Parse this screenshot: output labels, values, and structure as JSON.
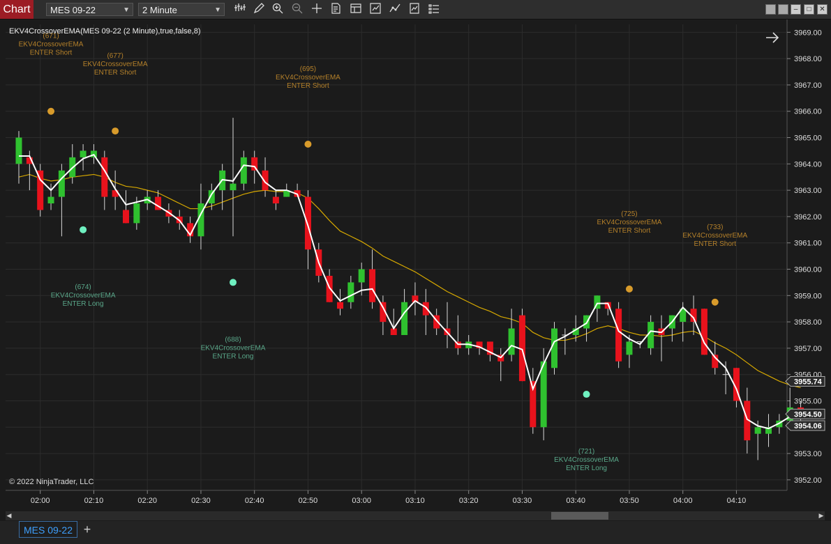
{
  "toolbar": {
    "chart_label": "Chart",
    "instrument": "MES 09-22",
    "interval": "2 Minute",
    "icons": [
      "bars-type-icon",
      "draw-pencil-icon",
      "zoom-in-icon",
      "zoom-out-icon",
      "crosshair-icon",
      "data-box-icon",
      "properties-icon",
      "chart-trader-icon",
      "strategies-icon",
      "indicators-icon",
      "templates-icon"
    ]
  },
  "window": {
    "buttons": [
      "minimize",
      "restore",
      "maximize",
      "close"
    ]
  },
  "chart": {
    "indicator_label": "EKV4CrossoverEMA(MES 09-22 (2 Minute),true,false,8)",
    "copyright": "© 2022 NinjaTrader, LLC",
    "price_badges": [
      {
        "value": "3955.74",
        "price": 3955.74
      },
      {
        "value": "3954.50",
        "price": 3954.5
      },
      {
        "value": "3954.06",
        "price": 3954.06
      }
    ],
    "annotations": [
      {
        "id": "(671)",
        "name": "EKV4CrossoverEMA",
        "action": "ENTER Short",
        "bar": 3,
        "side": "short",
        "price": 3966.0
      },
      {
        "id": "(677)",
        "name": "EKV4CrossoverEMA",
        "action": "ENTER Short",
        "bar": 9,
        "side": "short",
        "price": 3965.25
      },
      {
        "id": "(695)",
        "name": "EKV4CrossoverEMA",
        "action": "ENTER Short",
        "bar": 27,
        "side": "short",
        "price": 3964.75
      },
      {
        "id": "(725)",
        "name": "EKV4CrossoverEMA",
        "action": "ENTER Short",
        "bar": 57,
        "side": "short",
        "price": 3959.25
      },
      {
        "id": "(733)",
        "name": "EKV4CrossoverEMA",
        "action": "ENTER Short",
        "bar": 65,
        "side": "short",
        "price": 3958.75
      },
      {
        "id": "(674)",
        "name": "EKV4CrossoverEMA",
        "action": "ENTER Long",
        "bar": 6,
        "side": "long",
        "price": 3961.5
      },
      {
        "id": "(688)",
        "name": "EKV4CrossoverEMA",
        "action": "ENTER Long",
        "bar": 20,
        "side": "long",
        "price": 3959.5
      },
      {
        "id": "(721)",
        "name": "EKV4CrossoverEMA",
        "action": "ENTER Long",
        "bar": 53,
        "side": "long",
        "price": 3955.25
      }
    ]
  },
  "chart_data": {
    "type": "candlestick",
    "instrument": "MES 09-22",
    "interval": "2 Minute",
    "y_axis": {
      "min": 3951.6,
      "max": 3969.3,
      "ticks": [
        "3952.00",
        "3953.00",
        "3954.00",
        "3955.00",
        "3956.00",
        "3957.00",
        "3958.00",
        "3959.00",
        "3960.00",
        "3961.00",
        "3962.00",
        "3963.00",
        "3964.00",
        "3965.00",
        "3966.00",
        "3967.00",
        "3968.00",
        "3969.00"
      ]
    },
    "x_axis": {
      "labels": [
        "02:00",
        "02:10",
        "02:20",
        "02:30",
        "02:40",
        "02:50",
        "03:00",
        "03:10",
        "03:20",
        "03:30",
        "03:40",
        "03:50",
        "04:00",
        "04:10"
      ],
      "label_bar_index": [
        2,
        7,
        12,
        17,
        22,
        27,
        32,
        37,
        42,
        47,
        52,
        57,
        62,
        67
      ]
    },
    "colors": {
      "up": "#2fc12f",
      "down": "#e8121c",
      "ema": "#d6a800",
      "fast_line": "#ffffff",
      "short_marker": "#d89b2b",
      "long_marker": "#6ff0c0",
      "short_text": "#b5812a",
      "long_text": "#5aa88a"
    },
    "candles": [
      {
        "o": 3964.0,
        "h": 3965.25,
        "l": 3963.25,
        "c": 3965.0
      },
      {
        "o": 3964.25,
        "h": 3964.5,
        "l": 3963.0,
        "c": 3964.0
      },
      {
        "o": 3963.75,
        "h": 3964.0,
        "l": 3962.0,
        "c": 3962.25
      },
      {
        "o": 3962.5,
        "h": 3963.25,
        "l": 3962.25,
        "c": 3962.75
      },
      {
        "o": 3962.75,
        "h": 3964.0,
        "l": 3961.25,
        "c": 3963.75
      },
      {
        "o": 3963.5,
        "h": 3964.75,
        "l": 3963.25,
        "c": 3964.25
      },
      {
        "o": 3964.25,
        "h": 3964.75,
        "l": 3963.75,
        "c": 3964.5
      },
      {
        "o": 3964.25,
        "h": 3964.75,
        "l": 3964.0,
        "c": 3964.5
      },
      {
        "o": 3964.25,
        "h": 3964.5,
        "l": 3962.25,
        "c": 3962.75
      },
      {
        "o": 3963.0,
        "h": 3963.75,
        "l": 3962.25,
        "c": 3962.75
      },
      {
        "o": 3962.25,
        "h": 3963.0,
        "l": 3961.75,
        "c": 3961.75
      },
      {
        "o": 3961.75,
        "h": 3962.75,
        "l": 3961.5,
        "c": 3962.5
      },
      {
        "o": 3962.5,
        "h": 3963.0,
        "l": 3962.25,
        "c": 3962.75
      },
      {
        "o": 3962.75,
        "h": 3963.0,
        "l": 3962.25,
        "c": 3962.25
      },
      {
        "o": 3962.25,
        "h": 3962.5,
        "l": 3961.75,
        "c": 3962.0
      },
      {
        "o": 3962.0,
        "h": 3962.25,
        "l": 3961.5,
        "c": 3961.75
      },
      {
        "o": 3961.75,
        "h": 3962.0,
        "l": 3961.0,
        "c": 3961.25
      },
      {
        "o": 3961.25,
        "h": 3963.25,
        "l": 3960.75,
        "c": 3962.5
      },
      {
        "o": 3962.5,
        "h": 3963.25,
        "l": 3962.25,
        "c": 3963.0
      },
      {
        "o": 3963.0,
        "h": 3964.0,
        "l": 3962.25,
        "c": 3963.75
      },
      {
        "o": 3963.0,
        "h": 3965.75,
        "l": 3961.25,
        "c": 3963.25
      },
      {
        "o": 3963.25,
        "h": 3964.5,
        "l": 3963.0,
        "c": 3964.25
      },
      {
        "o": 3964.25,
        "h": 3964.5,
        "l": 3963.25,
        "c": 3963.75
      },
      {
        "o": 3963.75,
        "h": 3964.25,
        "l": 3962.75,
        "c": 3963.0
      },
      {
        "o": 3962.75,
        "h": 3963.0,
        "l": 3962.25,
        "c": 3962.5
      },
      {
        "o": 3962.75,
        "h": 3963.25,
        "l": 3962.75,
        "c": 3963.0
      },
      {
        "o": 3963.0,
        "h": 3963.25,
        "l": 3962.75,
        "c": 3962.75
      },
      {
        "o": 3962.75,
        "h": 3963.0,
        "l": 3960.0,
        "c": 3960.75
      },
      {
        "o": 3960.75,
        "h": 3961.0,
        "l": 3959.5,
        "c": 3959.75
      },
      {
        "o": 3959.75,
        "h": 3960.0,
        "l": 3958.75,
        "c": 3958.75
      },
      {
        "o": 3958.75,
        "h": 3959.25,
        "l": 3958.25,
        "c": 3958.5
      },
      {
        "o": 3958.75,
        "h": 3959.75,
        "l": 3958.5,
        "c": 3959.5
      },
      {
        "o": 3959.5,
        "h": 3960.25,
        "l": 3959.0,
        "c": 3960.0
      },
      {
        "o": 3960.0,
        "h": 3960.75,
        "l": 3958.5,
        "c": 3958.75
      },
      {
        "o": 3958.75,
        "h": 3959.0,
        "l": 3957.5,
        "c": 3958.0
      },
      {
        "o": 3957.75,
        "h": 3958.5,
        "l": 3957.5,
        "c": 3957.5
      },
      {
        "o": 3957.5,
        "h": 3959.25,
        "l": 3957.5,
        "c": 3958.75
      },
      {
        "o": 3959.0,
        "h": 3959.5,
        "l": 3958.25,
        "c": 3958.75
      },
      {
        "o": 3958.75,
        "h": 3959.25,
        "l": 3957.5,
        "c": 3958.25
      },
      {
        "o": 3958.25,
        "h": 3958.5,
        "l": 3957.5,
        "c": 3957.75
      },
      {
        "o": 3957.75,
        "h": 3958.75,
        "l": 3957.0,
        "c": 3957.5
      },
      {
        "o": 3957.25,
        "h": 3958.25,
        "l": 3956.75,
        "c": 3957.0
      },
      {
        "o": 3957.0,
        "h": 3957.5,
        "l": 3956.75,
        "c": 3957.25
      },
      {
        "o": 3957.25,
        "h": 3957.25,
        "l": 3956.75,
        "c": 3957.0
      },
      {
        "o": 3957.25,
        "h": 3957.25,
        "l": 3956.5,
        "c": 3956.75
      },
      {
        "o": 3956.75,
        "h": 3957.0,
        "l": 3955.75,
        "c": 3956.5
      },
      {
        "o": 3956.75,
        "h": 3958.5,
        "l": 3956.5,
        "c": 3957.75
      },
      {
        "o": 3958.25,
        "h": 3958.5,
        "l": 3955.75,
        "c": 3955.75
      },
      {
        "o": 3955.75,
        "h": 3956.25,
        "l": 3953.75,
        "c": 3954.0
      },
      {
        "o": 3954.0,
        "h": 3957.0,
        "l": 3953.5,
        "c": 3956.5
      },
      {
        "o": 3956.25,
        "h": 3958.0,
        "l": 3956.0,
        "c": 3957.75
      },
      {
        "o": 3957.5,
        "h": 3957.75,
        "l": 3956.75,
        "c": 3957.5
      },
      {
        "o": 3957.5,
        "h": 3958.25,
        "l": 3957.25,
        "c": 3957.75
      },
      {
        "o": 3957.75,
        "h": 3958.25,
        "l": 3957.25,
        "c": 3958.25
      },
      {
        "o": 3958.5,
        "h": 3959.0,
        "l": 3958.0,
        "c": 3959.0
      },
      {
        "o": 3958.75,
        "h": 3958.75,
        "l": 3958.25,
        "c": 3958.5
      },
      {
        "o": 3958.5,
        "h": 3958.75,
        "l": 3956.25,
        "c": 3956.5
      },
      {
        "o": 3956.75,
        "h": 3957.5,
        "l": 3956.25,
        "c": 3957.25
      },
      {
        "o": 3957.25,
        "h": 3957.25,
        "l": 3957.0,
        "c": 3957.25
      },
      {
        "o": 3957.0,
        "h": 3958.25,
        "l": 3956.75,
        "c": 3958.0
      },
      {
        "o": 3957.75,
        "h": 3958.25,
        "l": 3956.5,
        "c": 3957.5
      },
      {
        "o": 3957.75,
        "h": 3958.25,
        "l": 3957.25,
        "c": 3958.25
      },
      {
        "o": 3958.0,
        "h": 3958.75,
        "l": 3957.25,
        "c": 3958.5
      },
      {
        "o": 3958.5,
        "h": 3959.0,
        "l": 3957.5,
        "c": 3958.0
      },
      {
        "o": 3958.5,
        "h": 3958.5,
        "l": 3956.75,
        "c": 3956.75
      },
      {
        "o": 3956.75,
        "h": 3957.25,
        "l": 3956.0,
        "c": 3956.25
      },
      {
        "o": 3956.0,
        "h": 3956.5,
        "l": 3955.25,
        "c": 3956.0
      },
      {
        "o": 3956.25,
        "h": 3956.25,
        "l": 3954.75,
        "c": 3955.0
      },
      {
        "o": 3955.0,
        "h": 3955.5,
        "l": 3953.0,
        "c": 3953.5
      },
      {
        "o": 3953.75,
        "h": 3954.25,
        "l": 3952.75,
        "c": 3954.0
      },
      {
        "o": 3953.75,
        "h": 3954.5,
        "l": 3953.25,
        "c": 3954.0
      },
      {
        "o": 3954.0,
        "h": 3954.5,
        "l": 3953.75,
        "c": 3954.25
      },
      {
        "o": 3954.25,
        "h": 3955.5,
        "l": 3954.0,
        "c": 3954.75
      },
      {
        "o": 3954.75,
        "h": 3955.0,
        "l": 3954.25,
        "c": 3954.5
      }
    ],
    "ema": [
      3963.5,
      3963.6,
      3963.45,
      3963.35,
      3963.4,
      3963.5,
      3963.55,
      3963.6,
      3963.5,
      3963.3,
      3963.15,
      3963.1,
      3963.0,
      3962.9,
      3962.7,
      3962.5,
      3962.3,
      3962.3,
      3962.4,
      3962.55,
      3962.7,
      3962.85,
      3962.95,
      3963.0,
      3962.95,
      3962.95,
      3962.9,
      3962.7,
      3962.3,
      3961.85,
      3961.45,
      3961.25,
      3961.05,
      3960.8,
      3960.5,
      3960.3,
      3960.1,
      3959.9,
      3959.65,
      3959.4,
      3959.15,
      3958.95,
      3958.75,
      3958.55,
      3958.4,
      3958.2,
      3958.1,
      3957.95,
      3957.6,
      3957.4,
      3957.3,
      3957.3,
      3957.4,
      3957.55,
      3957.75,
      3957.85,
      3957.75,
      3957.6,
      3957.5,
      3957.5,
      3957.45,
      3957.5,
      3957.6,
      3957.65,
      3957.45,
      3957.2,
      3957.0,
      3956.75,
      3956.45,
      3956.15,
      3955.95,
      3955.75,
      3955.6,
      3955.5
    ],
    "fast_line": [
      3964.3,
      3964.3,
      3963.4,
      3963.0,
      3963.45,
      3963.85,
      3964.2,
      3964.35,
      3963.75,
      3963.05,
      3962.45,
      3962.55,
      3962.65,
      3962.4,
      3962.15,
      3961.85,
      3961.3,
      3962.1,
      3962.85,
      3963.4,
      3963.35,
      3963.95,
      3963.9,
      3963.3,
      3963.0,
      3963.0,
      3962.85,
      3961.65,
      3960.25,
      3959.3,
      3958.8,
      3959.0,
      3959.2,
      3959.25,
      3958.55,
      3957.75,
      3958.35,
      3958.8,
      3958.55,
      3958.05,
      3957.6,
      3957.15,
      3957.15,
      3957.05,
      3956.85,
      3956.65,
      3957.1,
      3956.95,
      3955.45,
      3956.4,
      3957.25,
      3957.45,
      3957.7,
      3957.95,
      3958.7,
      3958.7,
      3957.65,
      3957.35,
      3957.15,
      3957.65,
      3957.6,
      3958.0,
      3958.55,
      3958.15,
      3957.2,
      3956.65,
      3956.25,
      3955.45,
      3954.3,
      3954.05,
      3953.95,
      3954.15,
      3954.4,
      3954.5
    ]
  }
}
